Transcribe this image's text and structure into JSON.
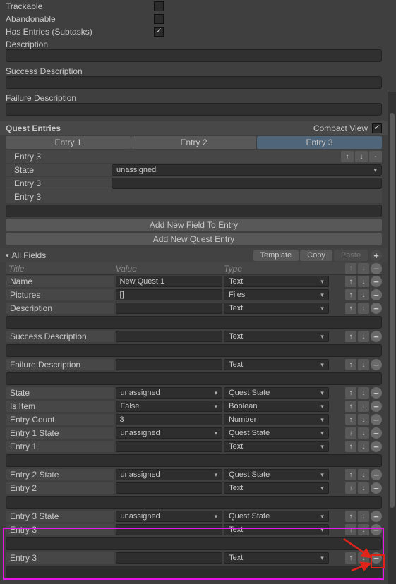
{
  "top": {
    "trackable": "Trackable",
    "abandonable": "Abandonable",
    "has_entries": "Has Entries (Subtasks)",
    "description": "Description",
    "success": "Success Description",
    "failure": "Failure Description",
    "trackable_checked": false,
    "abandonable_checked": false,
    "has_entries_checked": true
  },
  "entries": {
    "title": "Quest Entries",
    "compact": "Compact View",
    "tabs": [
      "Entry 1",
      "Entry 2",
      "Entry 3"
    ],
    "active_tab": 2,
    "r1_label": "Entry 3",
    "state_label": "State",
    "state_value": "unassigned",
    "r3_label": "Entry 3",
    "r4_label": "Entry 3",
    "btn_add_field": "Add New Field To Entry",
    "btn_add_entry": "Add New Quest Entry"
  },
  "fields": {
    "header": "All Fields",
    "template": "Template",
    "copy": "Copy",
    "paste": "Paste",
    "cols": {
      "title": "Title",
      "value": "Value",
      "type": "Type"
    },
    "rows": [
      {
        "title": "Name",
        "value": "New Quest 1",
        "type": "Text",
        "gap": "none"
      },
      {
        "title": "Pictures",
        "value": "[]",
        "type": "Files",
        "gap": "none"
      },
      {
        "title": "Description",
        "value": "",
        "type": "Text",
        "gap": "dark"
      },
      {
        "title": "Success Description",
        "value": "",
        "type": "Text",
        "gap": "dark"
      },
      {
        "title": "Failure Description",
        "value": "",
        "type": "Text",
        "gap": "dark"
      },
      {
        "title": "State",
        "value": "unassigned",
        "type": "Quest State",
        "gap": "none",
        "dd": true
      },
      {
        "title": "Is Item",
        "value": "False",
        "type": "Boolean",
        "gap": "none",
        "dd": true
      },
      {
        "title": "Entry Count",
        "value": "3",
        "type": "Number",
        "gap": "none"
      },
      {
        "title": "Entry 1 State",
        "value": "unassigned",
        "type": "Quest State",
        "gap": "none",
        "dd": true
      },
      {
        "title": "Entry 1",
        "value": "",
        "type": "Text",
        "gap": "dark"
      },
      {
        "title": "Entry 2 State",
        "value": "unassigned",
        "type": "Quest State",
        "gap": "none",
        "dd": true
      },
      {
        "title": "Entry 2",
        "value": "",
        "type": "Text",
        "gap": "dark"
      },
      {
        "title": "Entry 3 State",
        "value": "unassigned",
        "type": "Quest State",
        "gap": "none",
        "dd": true
      },
      {
        "title": "Entry 3",
        "value": "",
        "type": "Text",
        "gap": "dark"
      },
      {
        "title": "Entry 3",
        "value": "",
        "type": "Text",
        "gap": "empty"
      }
    ]
  },
  "icons": {
    "up": "↑",
    "down": "↓",
    "minus": "−",
    "plus": "+"
  }
}
